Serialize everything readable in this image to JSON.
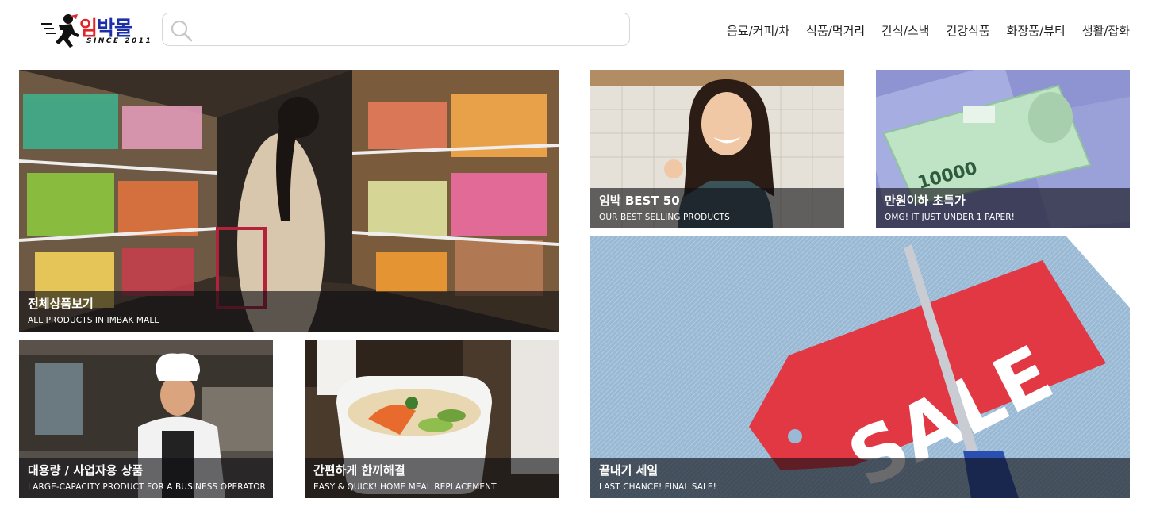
{
  "logo": {
    "text": "임박몰",
    "since": "SINCE 2011"
  },
  "search": {
    "placeholder": ""
  },
  "nav": {
    "items": [
      "음료/커피/차",
      "식품/먹거리",
      "간식/스낵",
      "건강식품",
      "화장품/뷰티",
      "생활/잡화"
    ]
  },
  "tiles": {
    "all": {
      "title": "전체상품보기",
      "subtitle": "ALL PRODUCTS IN IMBAK MALL"
    },
    "best": {
      "title": "임박 BEST 50",
      "subtitle": "OUR BEST SELLING PRODUCTS"
    },
    "under": {
      "title": "만원이하 초특가",
      "subtitle": "OMG! IT JUST UNDER 1 PAPER!"
    },
    "bulk": {
      "title": "대용량 / 사업자용 상품",
      "subtitle": "LARGE-CAPACITY PRODUCT FOR A BUSINESS OPERATOR"
    },
    "meal": {
      "title": "간편하게 한끼해결",
      "subtitle": "EASY & QUICK! HOME MEAL REPLACEMENT"
    },
    "sale": {
      "title": "끝내기 세일",
      "subtitle": "LAST CHANCE! FINAL SALE!",
      "tag_text": "SALE",
      "banknote_text": "10000"
    }
  }
}
